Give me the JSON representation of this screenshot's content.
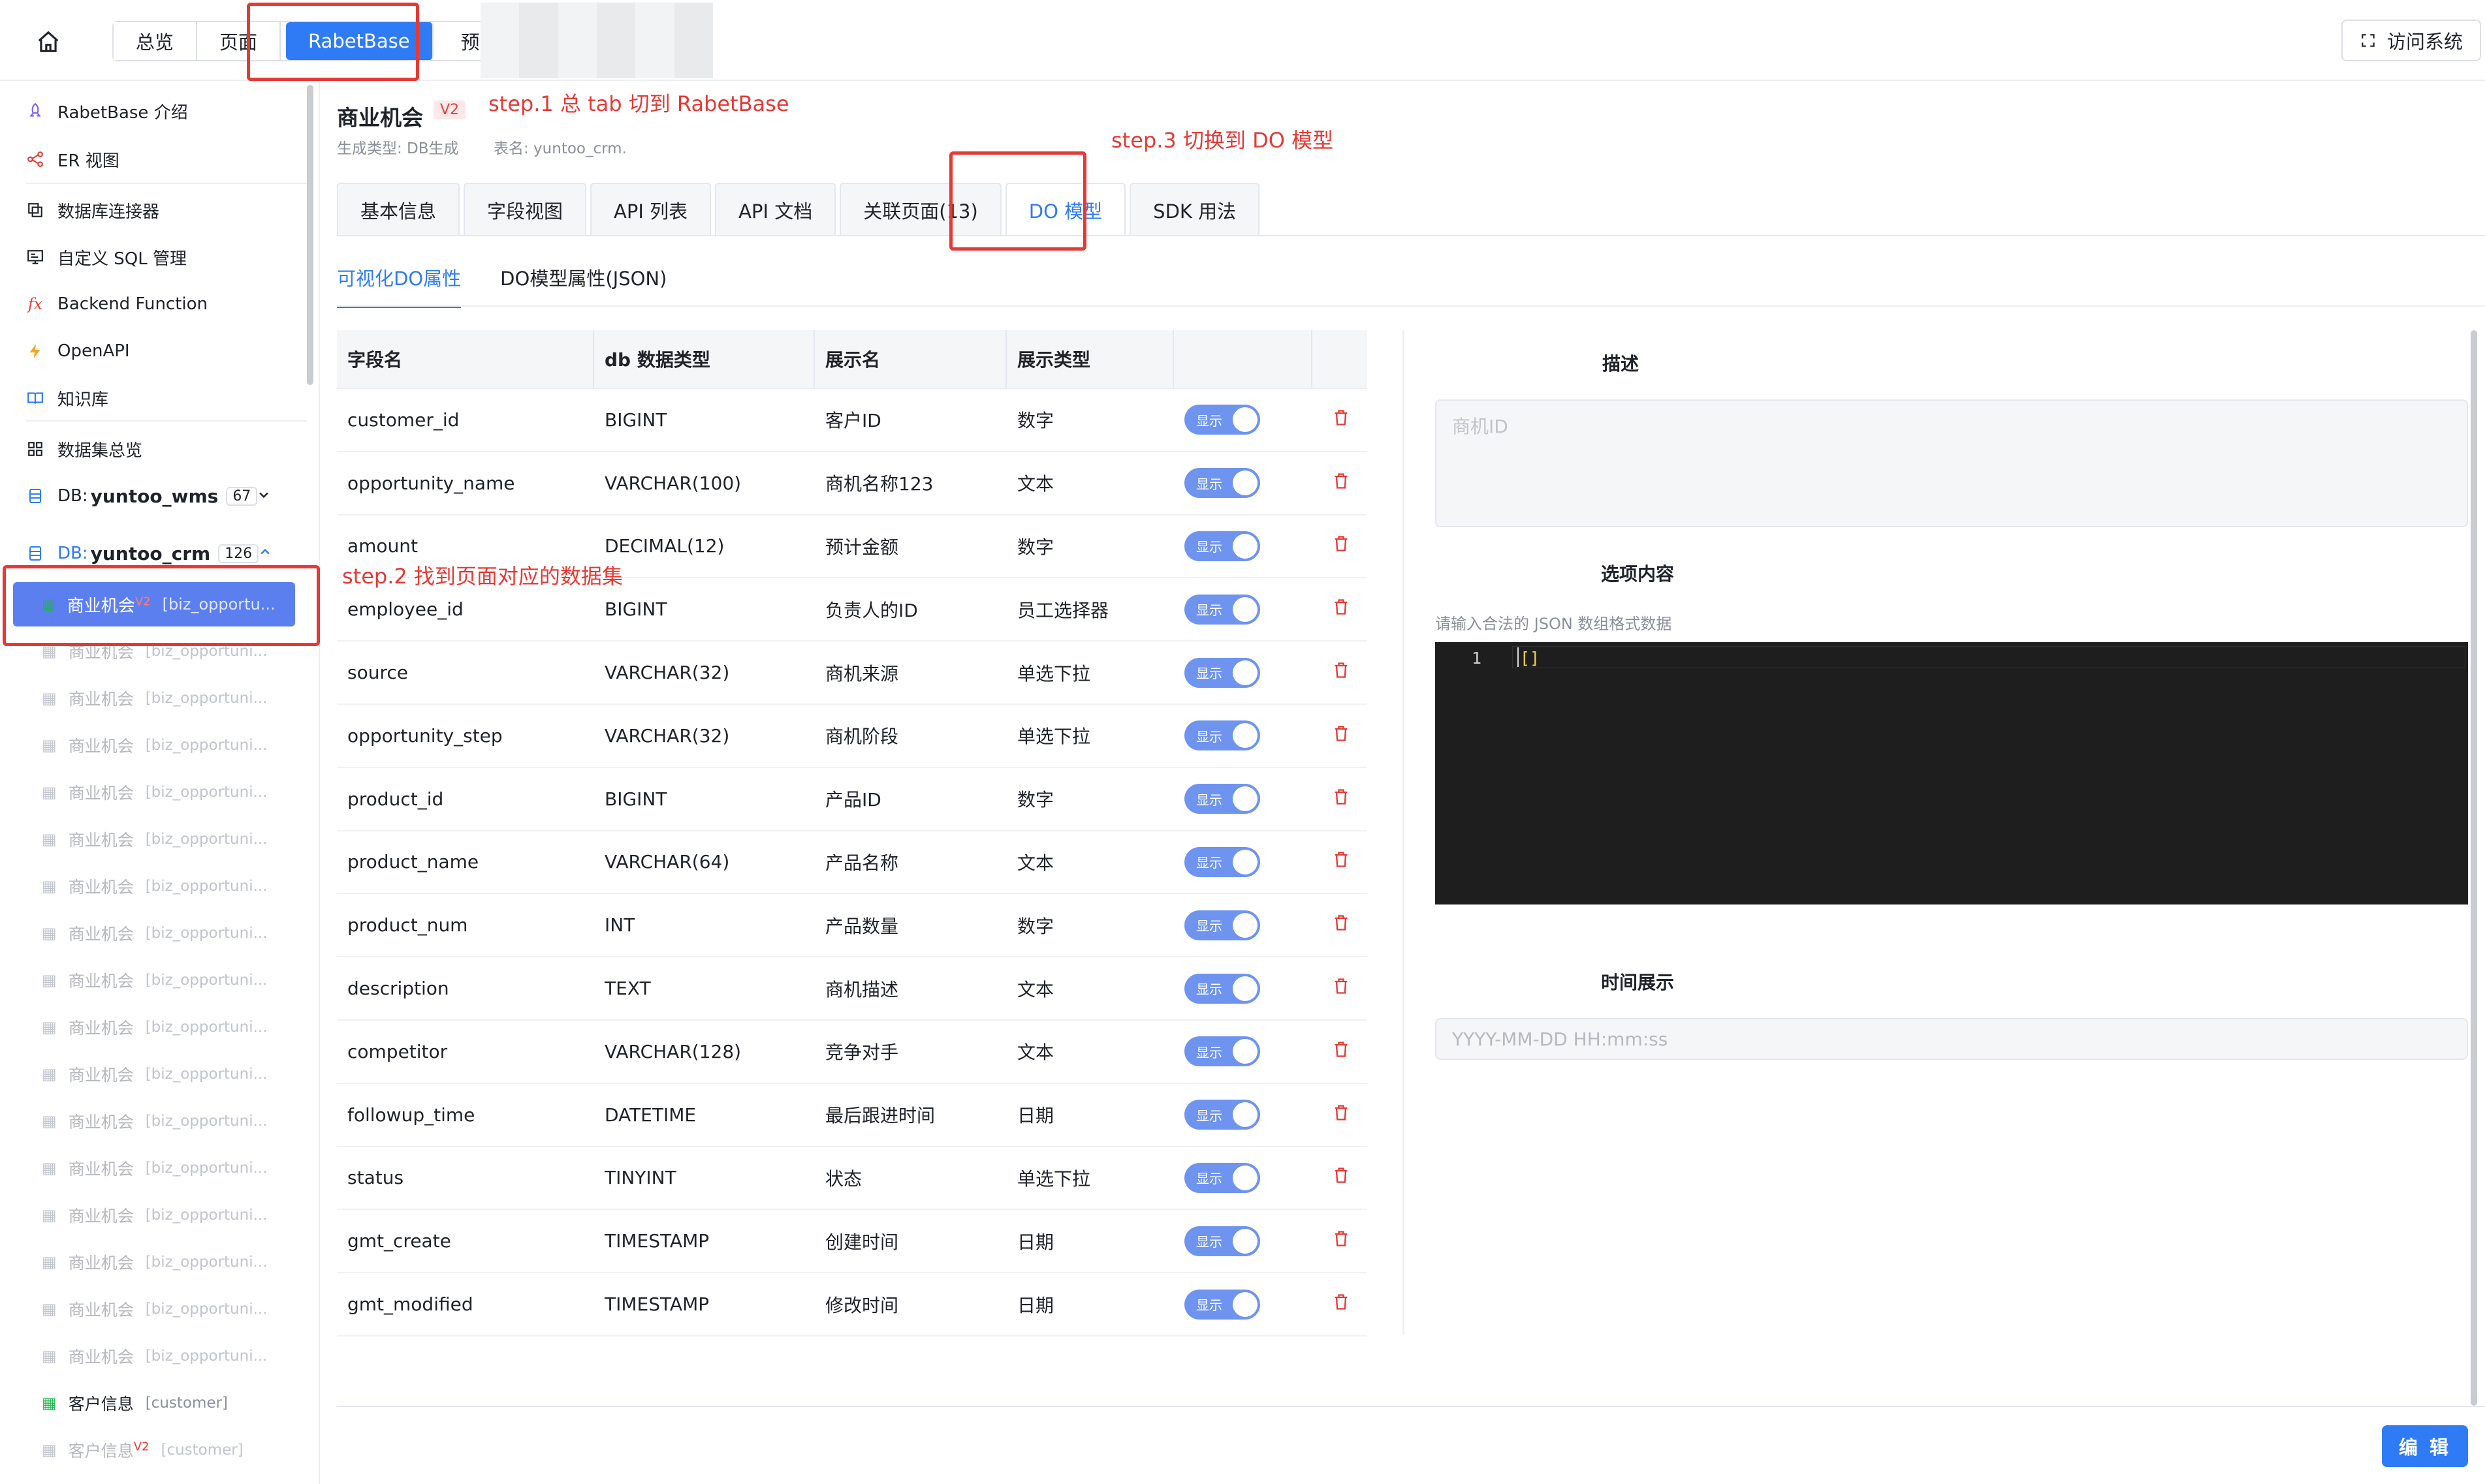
{
  "topbar": {
    "segments": [
      "总览",
      "页面",
      "RabetBase",
      "预览"
    ],
    "visit_label": "访问系统"
  },
  "sidebar": {
    "items": [
      {
        "label": "RabetBase 介绍",
        "icon": "rocket-icon",
        "color": "#7b61ff"
      },
      {
        "label": "ER 视图",
        "icon": "er-graph-icon",
        "color": "#e0403a"
      },
      {
        "label": "数据库连接器",
        "icon": "copy-icon",
        "color": "#1f2329"
      },
      {
        "label": "自定义 SQL 管理",
        "icon": "monitor-icon",
        "color": "#1f2329"
      },
      {
        "label": "Backend Function",
        "icon": "fx-icon",
        "color": "#e0403a"
      },
      {
        "label": "OpenAPI",
        "icon": "lightning-icon",
        "color": "#f5a623"
      },
      {
        "label": "知识库",
        "icon": "book-icon",
        "color": "#2f7bf5"
      },
      {
        "label": "数据集总览",
        "icon": "grid-icon",
        "color": "#1f2329"
      }
    ],
    "db_prefix": "DB:",
    "dbs": [
      {
        "name": "yuntoo_wms",
        "count": "67"
      },
      {
        "name": "yuntoo_crm",
        "count": "126"
      }
    ],
    "active_dataset": {
      "label": "商业机会",
      "sup": "V2",
      "sub": "[biz_opportu..."
    },
    "datasets": [
      {
        "label": "商业机会",
        "sub": "[biz_opportuni..."
      },
      {
        "label": "商业机会",
        "sub": "[biz_opportuni..."
      },
      {
        "label": "商业机会",
        "sub": "[biz_opportuni..."
      },
      {
        "label": "商业机会",
        "sub": "[biz_opportuni..."
      },
      {
        "label": "商业机会",
        "sub": "[biz_opportuni..."
      },
      {
        "label": "商业机会",
        "sub": "[biz_opportuni..."
      },
      {
        "label": "商业机会",
        "sub": "[biz_opportuni..."
      },
      {
        "label": "商业机会",
        "sub": "[biz_opportuni..."
      },
      {
        "label": "商业机会",
        "sub": "[biz_opportuni..."
      },
      {
        "label": "商业机会",
        "sub": "[biz_opportuni..."
      },
      {
        "label": "商业机会",
        "sub": "[biz_opportuni..."
      },
      {
        "label": "商业机会",
        "sub": "[biz_opportuni..."
      },
      {
        "label": "商业机会",
        "sub": "[biz_opportuni..."
      },
      {
        "label": "商业机会",
        "sub": "[biz_opportuni..."
      },
      {
        "label": "商业机会",
        "sub": "[biz_opportuni..."
      },
      {
        "label": "商业机会",
        "sub": "[biz_opportuni..."
      },
      {
        "label": "客户信息",
        "sub": "[customer]",
        "dark": true
      },
      {
        "label": "客户信息",
        "sup": "V2",
        "sub": "[customer]"
      }
    ]
  },
  "page": {
    "title": "商业机会",
    "badge": "V2",
    "gen_type": "生成类型: DB生成",
    "table_name": "表名: yuntoo_crm."
  },
  "tabs": [
    "基本信息",
    "字段视图",
    "API 列表",
    "API 文档",
    "关联页面(13)",
    "DO 模型",
    "SDK 用法"
  ],
  "subtabs": [
    "可视化DO属性",
    "DO模型属性(JSON)"
  ],
  "table": {
    "headers": [
      "字段名",
      "db 数据类型",
      "展示名",
      "展示类型",
      "",
      ""
    ],
    "toggle_label": "显示",
    "rows": [
      [
        "customer_id",
        "BIGINT",
        "客户ID",
        "数字"
      ],
      [
        "opportunity_name",
        "VARCHAR(100)",
        "商机名称123",
        "文本"
      ],
      [
        "amount",
        "DECIMAL(12)",
        "预计金额",
        "数字"
      ],
      [
        "employee_id",
        "BIGINT",
        "负责人的ID",
        "员工选择器"
      ],
      [
        "source",
        "VARCHAR(32)",
        "商机来源",
        "单选下拉"
      ],
      [
        "opportunity_step",
        "VARCHAR(32)",
        "商机阶段",
        "单选下拉"
      ],
      [
        "product_id",
        "BIGINT",
        "产品ID",
        "数字"
      ],
      [
        "product_name",
        "VARCHAR(64)",
        "产品名称",
        "文本"
      ],
      [
        "product_num",
        "INT",
        "产品数量",
        "数字"
      ],
      [
        "description",
        "TEXT",
        "商机描述",
        "文本"
      ],
      [
        "competitor",
        "VARCHAR(128)",
        "竞争对手",
        "文本"
      ],
      [
        "followup_time",
        "DATETIME",
        "最后跟进时间",
        "日期"
      ],
      [
        "status",
        "TINYINT",
        "状态",
        "单选下拉"
      ],
      [
        "gmt_create",
        "TIMESTAMP",
        "创建时间",
        "日期"
      ],
      [
        "gmt_modified",
        "TIMESTAMP",
        "修改时间",
        "日期"
      ]
    ]
  },
  "right": {
    "desc_label": "描述",
    "desc_placeholder": "商机ID",
    "options_label": "选项内容",
    "options_hint": "请输入合法的 JSON 数组格式数据",
    "code_line": "1",
    "code_text": "[]",
    "time_label": "时间展示",
    "time_placeholder": "YYYY-MM-DD HH:mm:ss"
  },
  "edit_label": "编 辑",
  "annotations": {
    "step1": "step.1 总 tab 切到 RabetBase",
    "step2": "step.2 找到页面对应的数据集",
    "step3": "step.3 切换到 DO 模型"
  },
  "colors": {
    "accent": "#2f7bf5",
    "annotation": "#e53935"
  }
}
